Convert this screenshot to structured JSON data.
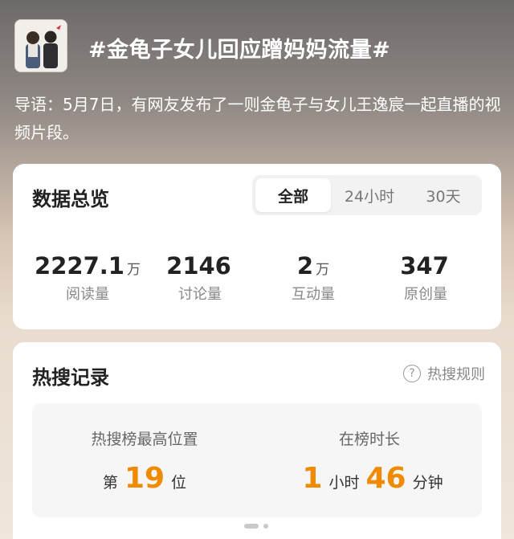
{
  "topic": {
    "title": "#金龟子女儿回应蹭妈妈流量#",
    "intro": "导语：5月7日，有网友发布了一则金龟子与女儿王逸宸一起直播的视频片段。"
  },
  "overview": {
    "title": "数据总览",
    "tabs": [
      {
        "label": "全部",
        "active": true
      },
      {
        "label": "24小时",
        "active": false
      },
      {
        "label": "30天",
        "active": false
      }
    ],
    "stats": [
      {
        "value": "2227.1",
        "unit": "万",
        "label": "阅读量"
      },
      {
        "value": "2146",
        "unit": "",
        "label": "讨论量"
      },
      {
        "value": "2",
        "unit": "万",
        "label": "互动量"
      },
      {
        "value": "347",
        "unit": "",
        "label": "原创量"
      }
    ]
  },
  "hot": {
    "title": "热搜记录",
    "rule_label": "热搜规则",
    "peak_label": "热搜榜最高位置",
    "peak_prefix": "第",
    "peak_value": "19",
    "peak_suffix": "位",
    "duration_label": "在榜时长",
    "hours": "1",
    "hours_unit": "小时",
    "minutes": "46",
    "minutes_unit": "分钟"
  },
  "colors": {
    "accent": "#f08a00"
  },
  "icons": {
    "help": "question-circle-icon"
  }
}
